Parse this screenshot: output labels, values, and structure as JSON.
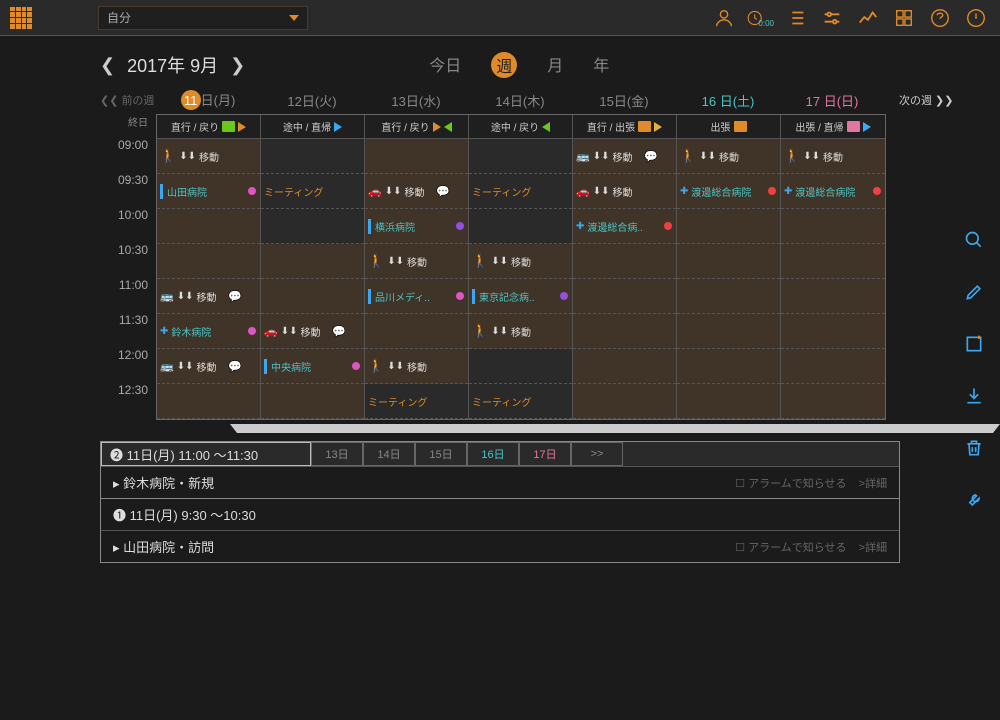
{
  "header": {
    "selector": "自分",
    "month": "2017年 9月",
    "today": "今日",
    "week": "週",
    "monthv": "月",
    "year": "年",
    "prev": "前の週",
    "next": "次の週"
  },
  "days": [
    {
      "n": "11",
      "d": "日(月)",
      "today": true
    },
    {
      "n": "12",
      "d": "日(火)"
    },
    {
      "n": "13",
      "d": "日(水)"
    },
    {
      "n": "14",
      "d": "日(木)"
    },
    {
      "n": "15",
      "d": "日(金)"
    },
    {
      "n": "16",
      "d": "日(土)",
      "sat": true
    },
    {
      "n": "17",
      "d": "日(日)",
      "sun": true
    }
  ],
  "allday": "終日",
  "colHead": [
    {
      "l": "直行 / 戻り",
      "i": [
        "b-grn",
        "arr-r-org"
      ]
    },
    {
      "l": "途中 / 直帰",
      "i": [
        "arr-r-blu"
      ]
    },
    {
      "l": "直行 / 戻り",
      "i": [
        "arr-r-org",
        "arr-l-grn"
      ]
    },
    {
      "l": "途中 / 戻り",
      "i": [
        "arr-l-grn"
      ]
    },
    {
      "l": "直行 / 出張",
      "i": [
        "b-org",
        "arr-r"
      ]
    },
    {
      "l": "出張",
      "i": [
        "b-org"
      ]
    },
    {
      "l": "出張 / 直帰",
      "i": [
        "b-pnk",
        "arr-r-blu"
      ]
    }
  ],
  "times": [
    "09:00",
    "09:30",
    "10:00",
    "10:30",
    "11:00",
    "11:30",
    "12:00",
    "12:30"
  ],
  "ev": {
    "move": "移動",
    "meet": "ミーティング",
    "yamada": "山田病院",
    "suzuki": "鈴木病院",
    "chuo": "中央病院",
    "yokohama": "横浜病院",
    "shinagawa": "品川メディ..",
    "tokyo": "東京記念病..",
    "watanabe": "渡邊総合病院",
    "watanabe2": "渡邊総合病.."
  },
  "detail": {
    "tab1": "❷ 11日(月) 11:00 〜11:30",
    "item1": "▸ 鈴木病院・新規",
    "tab2": "❶ 11日(月) 9:30 〜10:30",
    "item2": "▸ 山田病院・訪問",
    "alarm": "アラームで知らせる",
    "more": ">詳細",
    "tabs": [
      "13日",
      "14日",
      "15日",
      "16日",
      "17日",
      ">>"
    ]
  }
}
